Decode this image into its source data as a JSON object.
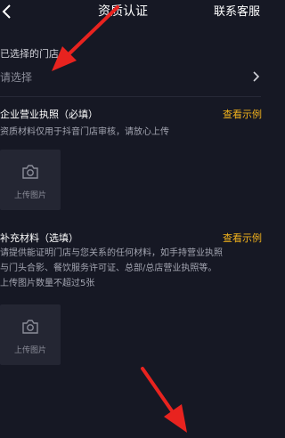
{
  "header": {
    "title": "资质认证",
    "support_label": "联系客服"
  },
  "store": {
    "label": "已选择的门店",
    "placeholder": "请选择"
  },
  "license": {
    "heading": "企业营业执照（必填）",
    "example_link": "查看示例",
    "description": "资质材料仅用于抖音门店审核，请放心上传",
    "upload_label": "上传图片"
  },
  "supplement": {
    "heading": "补充材料（选填）",
    "example_link": "查看示例",
    "description_line1": "请提供能证明门店与您关系的任何材料，如手持营业执照",
    "description_line2": "与门头合影、餐饮服务许可证、总部/总店营业执照等。",
    "limit_note": "上传图片数量不超过5张",
    "upload_label": "上传图片"
  },
  "colors": {
    "background": "#161824",
    "accent_link": "#f2b21c",
    "annotation_arrow": "#e8231f"
  },
  "icons": [
    "back-chevron-icon",
    "chevron-right-icon",
    "camera-icon"
  ]
}
